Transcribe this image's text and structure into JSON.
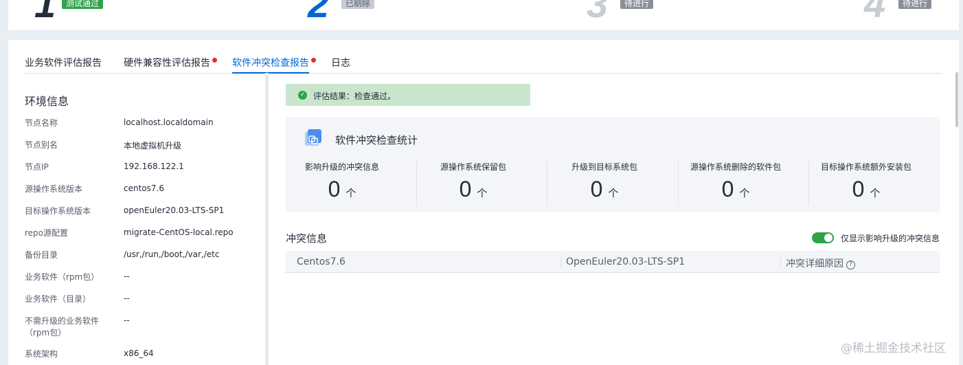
{
  "steps": [
    {
      "num": "1",
      "badge": "测试通过",
      "badge_color": "#2fa34a",
      "num_color": "#252b3a"
    },
    {
      "num": "2",
      "badge": "已剔除",
      "badge_color": "#c6cbd4",
      "num_color": "#0067d1"
    },
    {
      "num": "3",
      "badge": "待进行",
      "badge_color": "#8a8e99",
      "num_color": "#c6cbd4"
    },
    {
      "num": "4",
      "badge": "待进行",
      "badge_color": "#8a8e99",
      "num_color": "#c6cbd4"
    }
  ],
  "tabs": [
    {
      "label": "业务软件评估报告"
    },
    {
      "label": "硬件兼容性评估报告"
    },
    {
      "label": "软件冲突检查报告"
    },
    {
      "label": "日志"
    }
  ],
  "env": {
    "title": "环境信息",
    "rows": [
      {
        "key": "节点名称",
        "value": "localhost.localdomain"
      },
      {
        "key": "节点别名",
        "value": "本地虚拟机升级"
      },
      {
        "key": "节点IP",
        "value": "192.168.122.1"
      },
      {
        "key": "源操作系统版本",
        "value": "centos7.6"
      },
      {
        "key": "目标操作系统版本",
        "value": "openEuler20.03-LTS-SP1"
      },
      {
        "key": "repo源配置",
        "value": "migrate-CentOS-local.repo"
      },
      {
        "key": "备份目录",
        "value": "/usr,/run,/boot,/var,/etc"
      },
      {
        "key": "业务软件（rpm包）",
        "value": "--"
      },
      {
        "key": "业务软件（目录）",
        "value": "--"
      },
      {
        "key": "不需升级的业务软件（rpm包）",
        "value": "--"
      },
      {
        "key": "系统架构",
        "value": "x86_64"
      }
    ]
  },
  "alert": {
    "text": "评估结果：检查通过。"
  },
  "stats": {
    "title": "软件冲突检查统计",
    "unit": "个",
    "items": [
      {
        "label": "影响升级的冲突信息",
        "value": "0"
      },
      {
        "label": "源操作系统保留包",
        "value": "0"
      },
      {
        "label": "升级到目标系统包",
        "value": "0"
      },
      {
        "label": "源操作系统删除的软件包",
        "value": "0"
      },
      {
        "label": "目标操作系统额外安装包",
        "value": "0"
      }
    ]
  },
  "conflict": {
    "title": "冲突信息",
    "toggle_label": "仅显示影响升级的冲突信息",
    "toggle_on": true,
    "columns": [
      "Centos7.6",
      "OpenEuler20.03-LTS-SP1",
      "冲突详细原因"
    ]
  },
  "watermark": "@稀土掘金技术社区"
}
